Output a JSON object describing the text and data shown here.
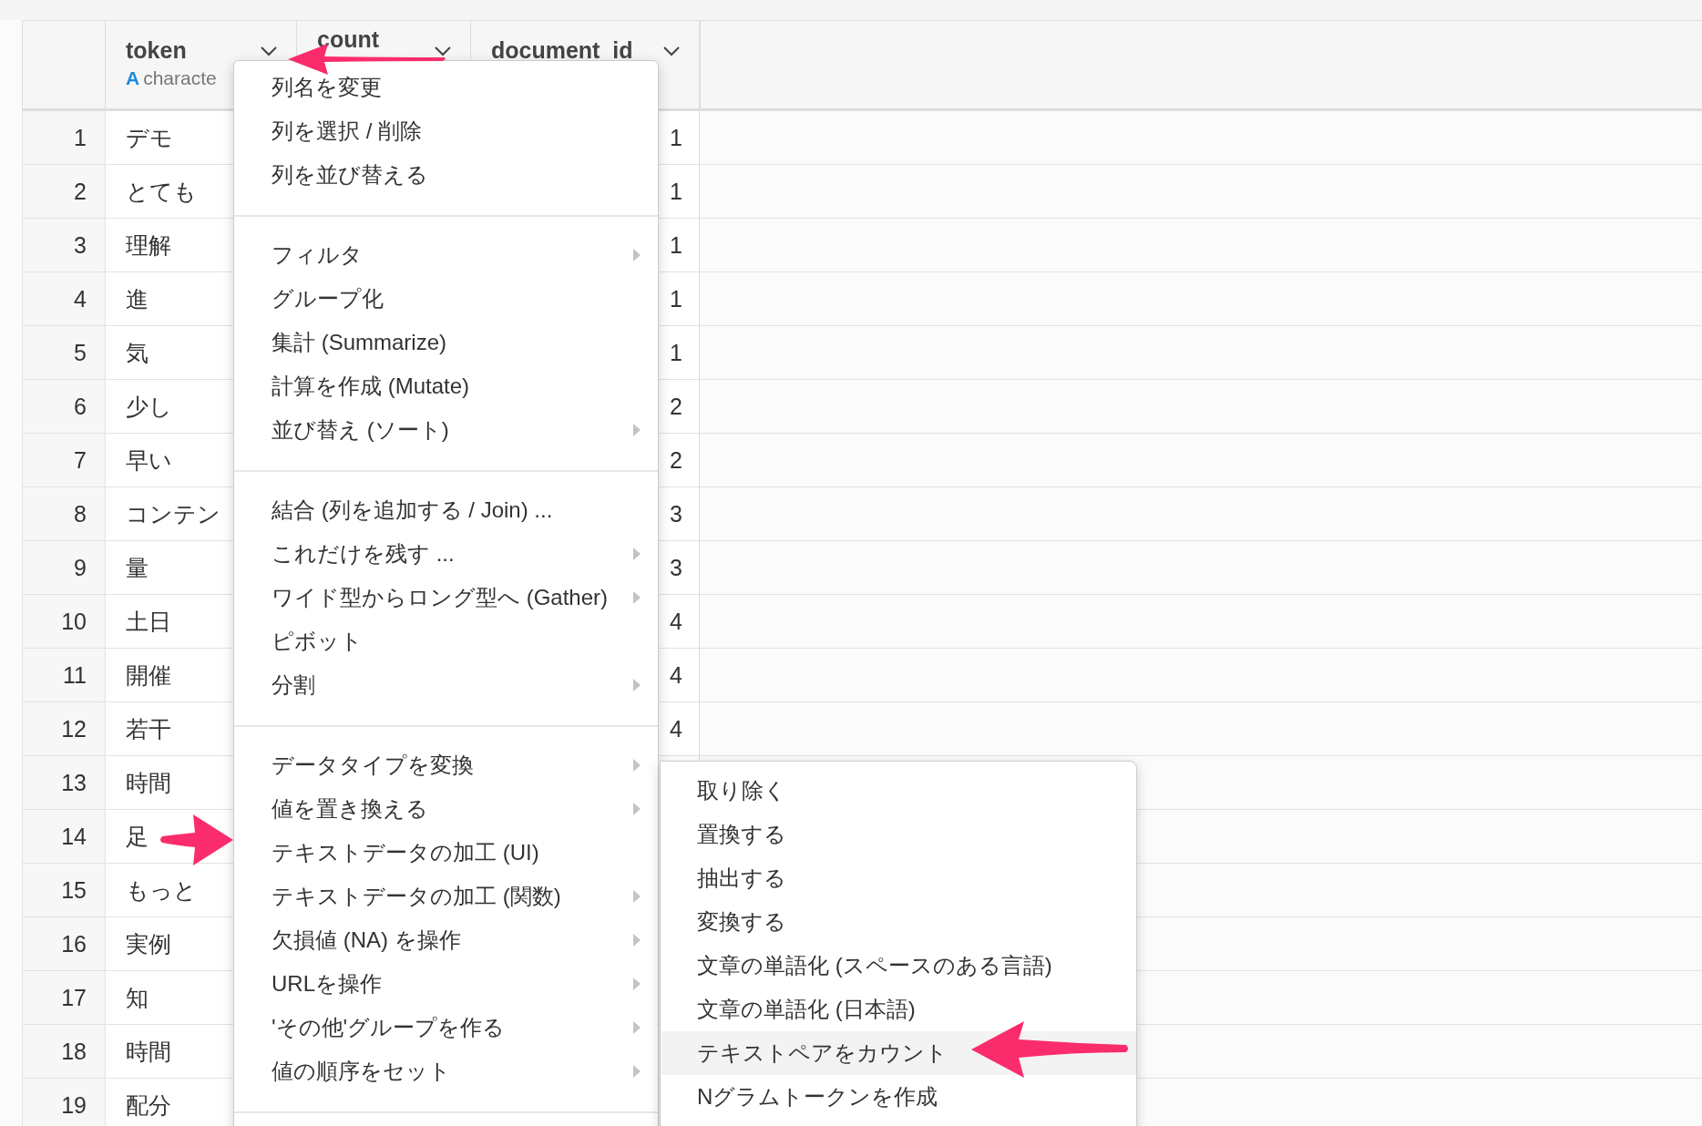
{
  "table": {
    "columns": [
      {
        "name": "token",
        "type_icon": "A",
        "type": "characte"
      },
      {
        "name": "count"
      },
      {
        "name": "document_id"
      }
    ],
    "rows": [
      {
        "index": "1",
        "token": "デモ",
        "document_id": "1"
      },
      {
        "index": "2",
        "token": "とても",
        "document_id": "1"
      },
      {
        "index": "3",
        "token": "理解",
        "document_id": "1"
      },
      {
        "index": "4",
        "token": "進",
        "document_id": "1"
      },
      {
        "index": "5",
        "token": "気",
        "document_id": "1"
      },
      {
        "index": "6",
        "token": "少し",
        "document_id": "2"
      },
      {
        "index": "7",
        "token": "早い",
        "document_id": "2"
      },
      {
        "index": "8",
        "token": "コンテン",
        "document_id": "3"
      },
      {
        "index": "9",
        "token": "量",
        "document_id": "3"
      },
      {
        "index": "10",
        "token": "土日",
        "document_id": "4"
      },
      {
        "index": "11",
        "token": "開催",
        "document_id": "4"
      },
      {
        "index": "12",
        "token": "若干",
        "document_id": "4"
      },
      {
        "index": "13",
        "token": "時間"
      },
      {
        "index": "14",
        "token": "足"
      },
      {
        "index": "15",
        "token": "もっと"
      },
      {
        "index": "16",
        "token": "実例"
      },
      {
        "index": "17",
        "token": "知"
      },
      {
        "index": "18",
        "token": "時間"
      },
      {
        "index": "19",
        "token": "配分"
      }
    ]
  },
  "column_menu": {
    "sections": [
      {
        "items": [
          {
            "label": "列名を変更",
            "submenu": false
          },
          {
            "label": "列を選択 / 削除",
            "submenu": false
          },
          {
            "label": "列を並び替える",
            "submenu": false
          }
        ]
      },
      {
        "items": [
          {
            "label": "フィルタ",
            "submenu": true
          },
          {
            "label": "グループ化",
            "submenu": false
          },
          {
            "label": "集計 (Summarize)",
            "submenu": false
          },
          {
            "label": "計算を作成 (Mutate)",
            "submenu": false
          },
          {
            "label": "並び替え (ソート)",
            "submenu": true
          }
        ]
      },
      {
        "items": [
          {
            "label": "結合 (列を追加する / Join) ...",
            "submenu": false
          },
          {
            "label": "これだけを残す ...",
            "submenu": true
          },
          {
            "label": "ワイド型からロング型へ (Gather)",
            "submenu": true
          },
          {
            "label": "ピボット",
            "submenu": false
          },
          {
            "label": "分割",
            "submenu": true
          }
        ]
      },
      {
        "items": [
          {
            "label": "データタイプを変換",
            "submenu": true
          },
          {
            "label": "値を置き換える",
            "submenu": true
          },
          {
            "label": "テキストデータの加工 (UI)",
            "submenu": false
          },
          {
            "label": "テキストデータの加工 (関数)",
            "submenu": true
          },
          {
            "label": "欠損値 (NA) を操作",
            "submenu": true
          },
          {
            "label": "URLを操作",
            "submenu": true
          },
          {
            "label": "'その他'グループを作る",
            "submenu": true
          },
          {
            "label": "値の順序をセット",
            "submenu": true
          }
        ]
      }
    ]
  },
  "submenu": {
    "items": [
      {
        "label": "取り除く",
        "selected": false
      },
      {
        "label": "置換する",
        "selected": false
      },
      {
        "label": "抽出する",
        "selected": false
      },
      {
        "label": "変換する",
        "selected": false
      },
      {
        "label": "文章の単語化 (スペースのある言語)",
        "selected": false
      },
      {
        "label": "文章の単語化 (日本語)",
        "selected": false
      },
      {
        "label": "テキストペアをカウント",
        "selected": true
      },
      {
        "label": "Nグラムトークンを作成",
        "selected": false
      }
    ]
  }
}
